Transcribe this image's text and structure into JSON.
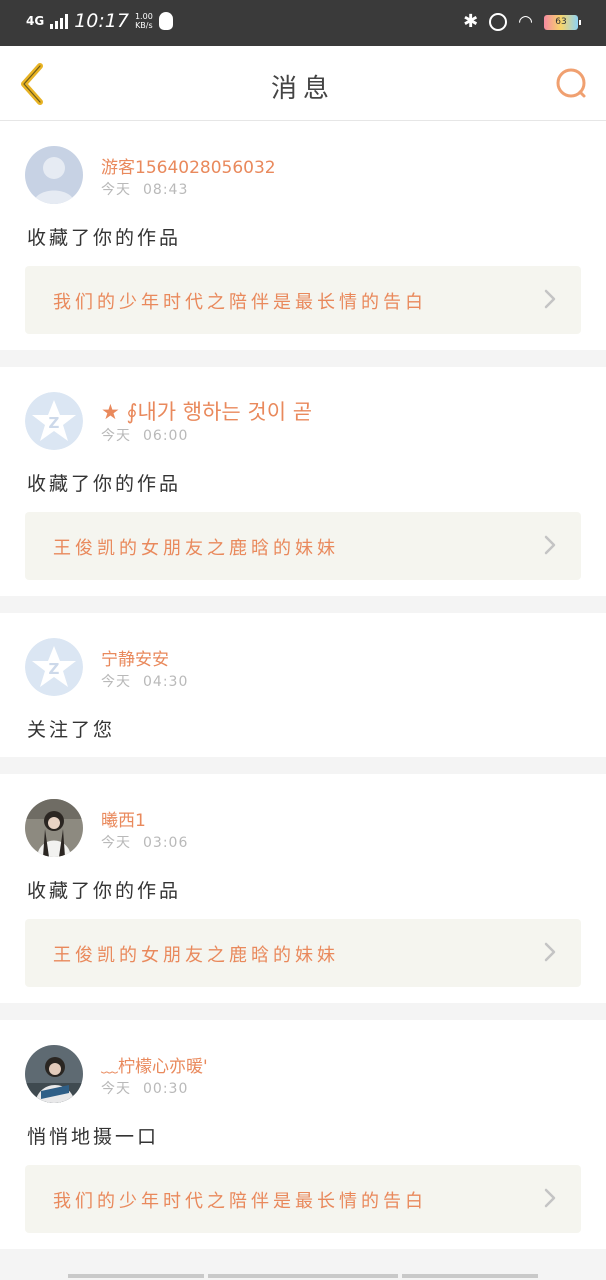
{
  "status_bar": {
    "network": "4G",
    "time": "10:17",
    "speed_value": "1.00",
    "speed_unit": "KB/s",
    "battery": "63",
    "icons": [
      "signal-icon",
      "qq-icon",
      "bluetooth-icon",
      "alarm-icon",
      "wifi-icon",
      "battery-icon"
    ]
  },
  "header": {
    "title": "消息",
    "back_icon": "chevron-left-icon",
    "search_icon": "search-icon"
  },
  "colors": {
    "accent": "#e9895c",
    "back_icon": "#e8b324",
    "work_box_bg": "#f5f5ef",
    "time_text": "#b9b9b9"
  },
  "messages": [
    {
      "username": "游客1564028056032",
      "date": "今天",
      "time": "08:43",
      "action": "收藏了你的作品",
      "work_title": "我们的少年时代之陪伴是最长情的告白",
      "avatar": "default-user-avatar"
    },
    {
      "username": "★ ∮내가 행하는 것이 곧",
      "date": "今天",
      "time": "06:00",
      "action": "收藏了你的作品",
      "work_title": "王俊凯的女朋友之鹿晗的妹妹",
      "avatar": "qzone-star-avatar"
    },
    {
      "username": "宁静安安",
      "date": "今天",
      "time": "04:30",
      "action": "关注了您",
      "avatar": "qzone-star-avatar"
    },
    {
      "username": "曦西1",
      "date": "今天",
      "time": "03:06",
      "action": "收藏了你的作品",
      "work_title": "王俊凯的女朋友之鹿晗的妹妹",
      "avatar": "photo-avatar"
    },
    {
      "username": "﹏柠檬心亦暖'",
      "date": "今天",
      "time": "00:30",
      "action": "悄悄地摄一口",
      "work_title": "我们的少年时代之陪伴是最长情的告白",
      "avatar": "photo-avatar"
    }
  ]
}
